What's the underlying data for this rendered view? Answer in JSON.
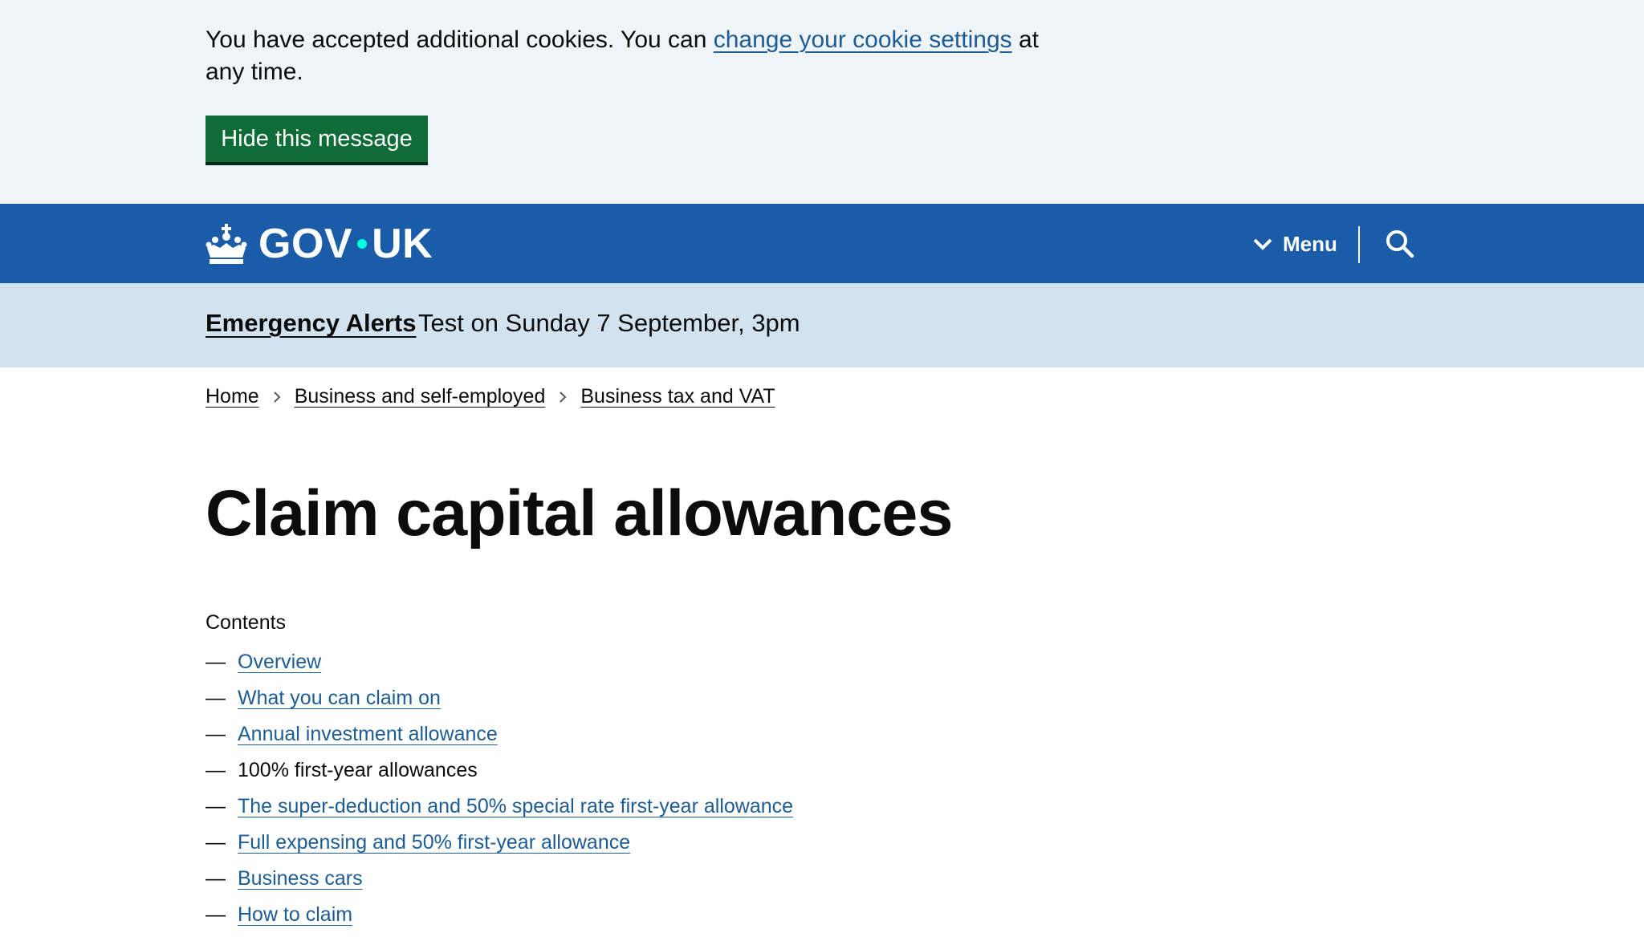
{
  "cookie_banner": {
    "text_before": "You have accepted additional cookies. You can ",
    "link_text": "change your cookie settings",
    "text_after": " at any time.",
    "hide_button": "Hide this message"
  },
  "header": {
    "logo_left": "GOV",
    "logo_right": "UK",
    "menu_label": "Menu",
    "icons": {
      "crown": "crown-icon",
      "chevron": "chevron-down-icon",
      "search": "search-icon"
    }
  },
  "alert": {
    "link_text": "Emergency Alerts",
    "description": "Test on Sunday 7 September, 3pm"
  },
  "breadcrumbs": [
    {
      "label": "Home"
    },
    {
      "label": "Business and self-employed"
    },
    {
      "label": "Business tax and VAT"
    }
  ],
  "page": {
    "title": "Claim capital allowances",
    "contents_label": "Contents"
  },
  "contents": [
    {
      "dash": "—",
      "label": "Overview"
    },
    {
      "dash": "—",
      "label": "What you can claim on"
    },
    {
      "dash": "—",
      "label": "Annual investment allowance"
    },
    {
      "dash": "—",
      "label": "100% first-year allowances"
    },
    {
      "dash": "—",
      "label": "The super-deduction and 50% special rate first-year allowance"
    },
    {
      "dash": "—",
      "label": "Full expensing and 50% first-year allowance"
    },
    {
      "dash": "—",
      "label": "Business cars"
    },
    {
      "dash": "—",
      "label": "How to claim"
    }
  ],
  "colors": {
    "header_blue": "#1a5ca8",
    "link_blue": "#1d5c94",
    "button_green": "#0f6c37",
    "alert_bg": "#d2e2ef",
    "cookie_bg": "#eef4f7",
    "logo_dot": "#00ffe0"
  }
}
